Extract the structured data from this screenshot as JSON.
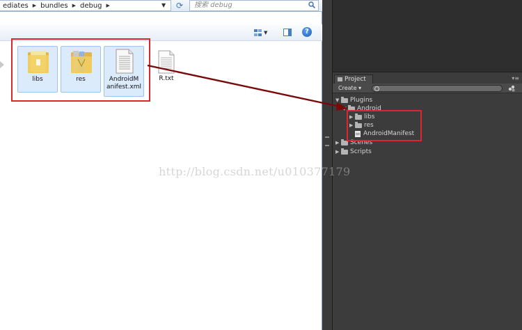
{
  "explorer": {
    "breadcrumb": [
      "ediates",
      "bundles",
      "debug"
    ],
    "search_placeholder": "搜索 debug",
    "help_label": "?",
    "files": [
      {
        "name": "libs",
        "type": "folder",
        "selected": true
      },
      {
        "name": "res",
        "type": "folder",
        "selected": true
      },
      {
        "name_line1": "AndroidM",
        "name_line2": "anifest.xml",
        "type": "xml-file",
        "selected": true
      },
      {
        "name": "R.txt",
        "type": "text-file",
        "selected": false
      }
    ]
  },
  "unity": {
    "tab_label": "Project",
    "create_label": "Create ▾",
    "tree": {
      "plugins": "Plugins",
      "android": "Android",
      "libs": "libs",
      "res": "res",
      "manifest": "AndroidManifest",
      "scenes": "Scenes",
      "scripts": "Scripts"
    }
  },
  "watermark": "http://blog.csdn.net/u010377179",
  "colors": {
    "highlight_box": "#e0262d",
    "arrow": "#7a0a0a",
    "unity_bg": "#3c3c3c",
    "selection": "#dcebfc"
  }
}
